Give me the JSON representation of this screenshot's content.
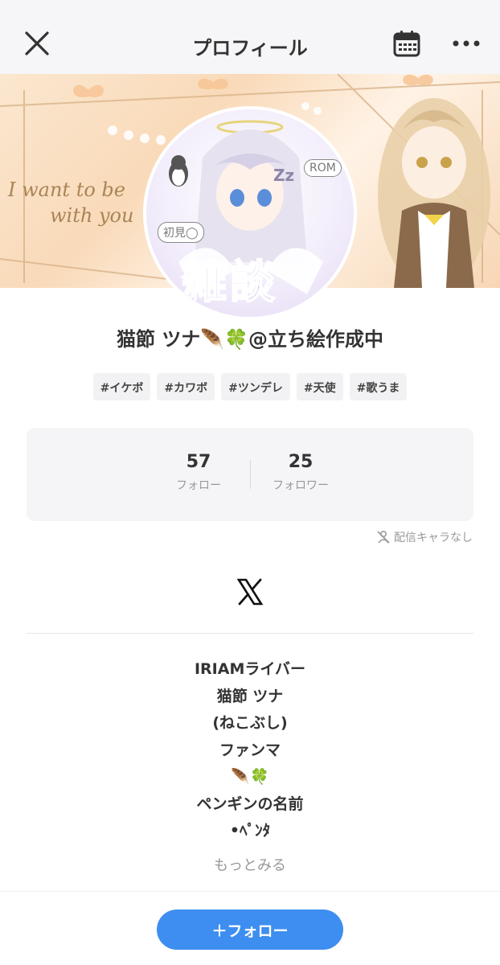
{
  "nav": {
    "title": "プロフィール",
    "close_icon": "close-icon",
    "calendar_icon": "calendar-icon",
    "more_icon": "more-horizontal-icon"
  },
  "header": {
    "script_text_1": "I want to be",
    "script_text_2": "with you",
    "accent_color": "#f7d6b4"
  },
  "avatar": {
    "badge_rom": "ROM",
    "badge_first": "初見◯",
    "badge_zzz": "Zz",
    "title_art": "雑談"
  },
  "profile": {
    "name": "猫節 ツナ🪶🍀@立ち絵作成中",
    "tags": [
      "#イケボ",
      "#カワボ",
      "#ツンデレ",
      "#天使",
      "#歌うま"
    ]
  },
  "stats": {
    "follow_count": "57",
    "follow_label": "フォロー",
    "follower_count": "25",
    "follower_label": "フォロワー"
  },
  "no_character": "配信キャラなし",
  "social": {
    "x_icon": "x-logo-icon"
  },
  "bio": {
    "lines": [
      "IRIAMライバー",
      "猫節 ツナ",
      "(ねこぶし)",
      "ファンマ",
      "🪶🍀",
      "ペンギンの名前",
      "•ﾍﾟﾝﾀ"
    ],
    "more": "もっとみる"
  },
  "footer": {
    "follow_button": "＋フォロー",
    "accent": "#3d8ef0"
  }
}
